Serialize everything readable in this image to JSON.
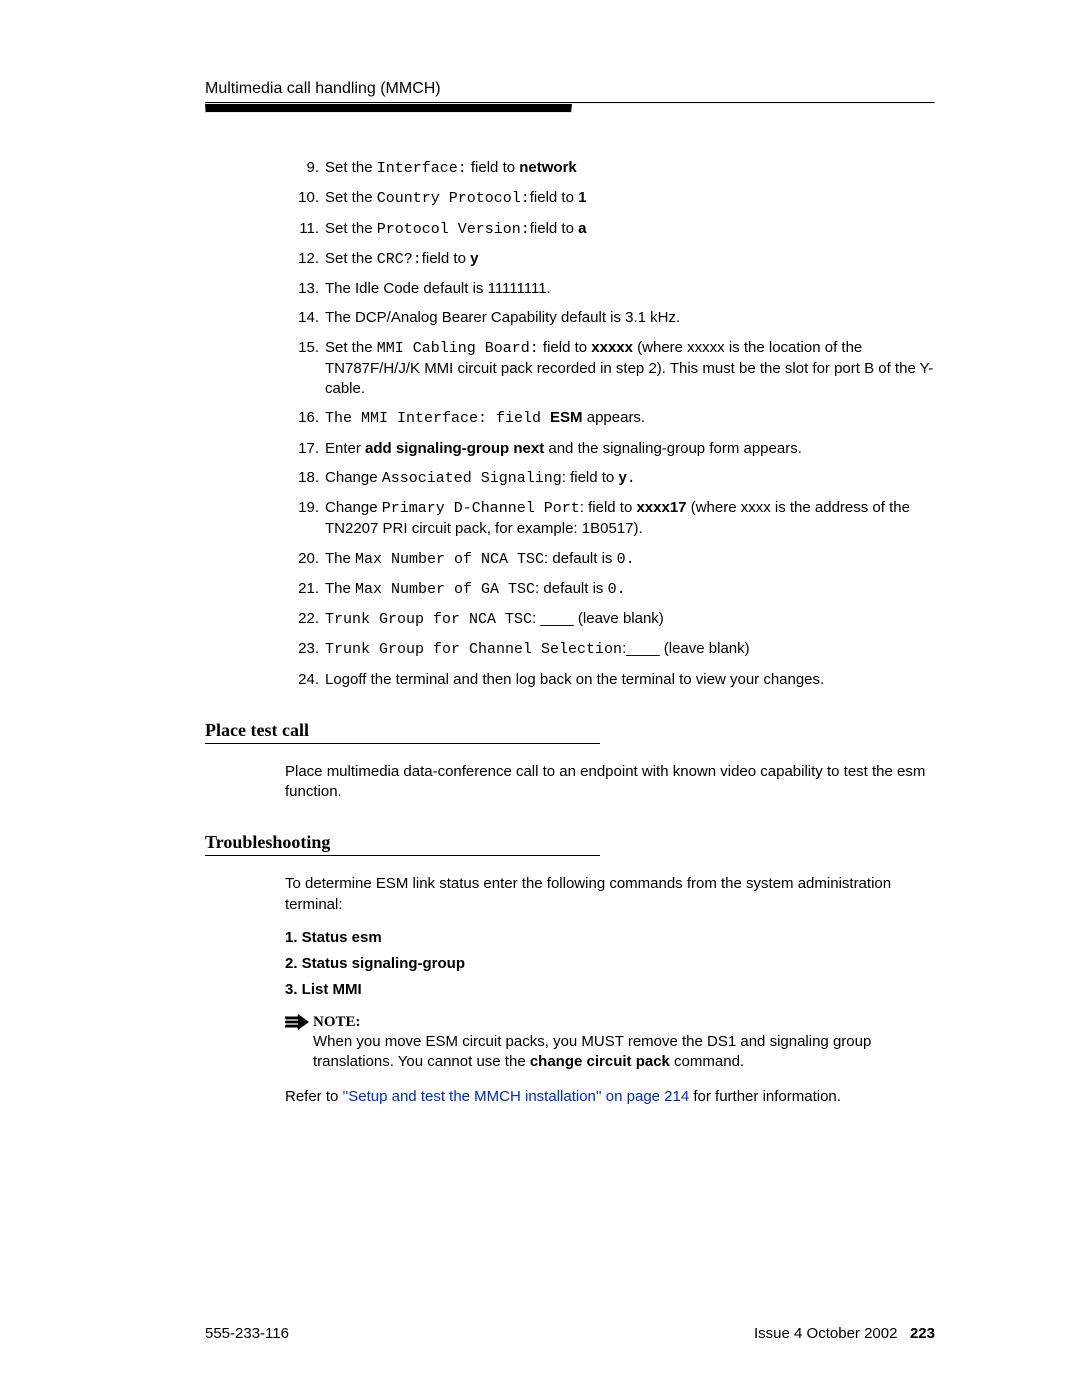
{
  "header": {
    "title": "Multimedia call handling (MMCH)"
  },
  "steps": [
    {
      "n": "9.",
      "parts": [
        "Set the ",
        {
          "mono": "Interface:"
        },
        " field to ",
        {
          "b": "network"
        }
      ]
    },
    {
      "n": "10.",
      "parts": [
        "Set the ",
        {
          "mono": "Country Protocol:"
        },
        "field to ",
        {
          "b": "1"
        }
      ]
    },
    {
      "n": "11.",
      "parts": [
        "Set the ",
        {
          "mono": "Protocol Version:"
        },
        "field to ",
        {
          "b": "a"
        }
      ]
    },
    {
      "n": "12.",
      "parts": [
        "Set the ",
        {
          "mono": "CRC?:"
        },
        "field to ",
        {
          "b": "y"
        }
      ]
    },
    {
      "n": "13.",
      "parts": [
        "The Idle Code default is 11111111."
      ]
    },
    {
      "n": "14.",
      "parts": [
        "The DCP/Analog Bearer Capability default is 3.1 kHz."
      ]
    },
    {
      "n": "15.",
      "parts": [
        "Set the ",
        {
          "mono": "MMI Cabling Board:"
        },
        " field to  ",
        {
          "b": "xxxxx"
        },
        " (where xxxxx is the location of the TN787F/H/J/K MMI circuit pack recorded in step 2). This must be the slot for port B of the Y-cable."
      ]
    },
    {
      "n": "16.",
      "parts": [
        {
          "mono": "The MMI Interface: field "
        },
        {
          "b": "ESM"
        },
        " appears."
      ]
    },
    {
      "n": "17.",
      "parts": [
        "Enter ",
        {
          "b": "add signaling-group next"
        },
        " and the signaling-group form appears."
      ]
    },
    {
      "n": "18.",
      "parts": [
        "Change ",
        {
          "mono": "Associated Signaling"
        },
        ": field to ",
        {
          "b": "y"
        },
        {
          "mono": "."
        }
      ]
    },
    {
      "n": "19.",
      "parts": [
        "Change ",
        {
          "mono": "Primary D-Channel Port"
        },
        ": field to ",
        {
          "b": "xxxx17"
        },
        " (where xxxx is the address of the TN2207 PRI circuit pack, for example: 1B0517)."
      ]
    },
    {
      "n": "20.",
      "parts": [
        "The ",
        {
          "mono": "Max Number of NCA TSC"
        },
        ": default is ",
        {
          "mono": "0."
        }
      ]
    },
    {
      "n": "21.",
      "parts": [
        "The ",
        {
          "mono": "Max Number of GA TSC"
        },
        ": default is ",
        {
          "mono": "0."
        }
      ]
    },
    {
      "n": "22.",
      "parts": [
        {
          "mono": "Trunk Group for NCA TSC"
        },
        ": ____ (leave blank)"
      ]
    },
    {
      "n": "23.",
      "parts": [
        {
          "mono": "Trunk Group for Channel Selection"
        },
        ":____ (leave blank)"
      ]
    },
    {
      "n": "24.",
      "parts": [
        "Logoff the terminal and then log back on the terminal to view your changes."
      ]
    }
  ],
  "section1": {
    "title": "Place test call",
    "para": "Place multimedia data-conference call to an endpoint with known video capability to test the esm function."
  },
  "section2": {
    "title": "Troubleshooting",
    "intro": "To determine ESM link status enter the following commands from the system administration terminal:",
    "list": [
      "1. Status esm",
      "2. Status signaling-group",
      "3. List MMI"
    ],
    "note_label": "NOTE:",
    "note_body_pre": "When you move ESM circuit packs, you MUST remove the DS1 and signaling group translations. You cannot use the ",
    "note_bold": "change circuit pack",
    "note_body_post": " command.",
    "refer_pre": "Refer to ",
    "refer_link": "''Setup and test the MMCH installation'' on page 214",
    "refer_post": " for further information."
  },
  "footer": {
    "left": "555-233-116",
    "right_text": "Issue 4  October 2002",
    "page": "223"
  }
}
